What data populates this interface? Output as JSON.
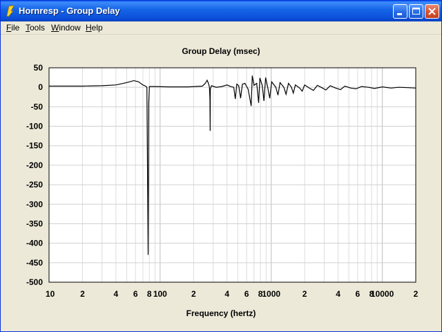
{
  "window": {
    "title": "Hornresp - Group Delay",
    "controls": [
      "minimize",
      "maximize",
      "close"
    ]
  },
  "menu": {
    "items": [
      {
        "label": "File",
        "accel": "F",
        "rest": "ile"
      },
      {
        "label": "Tools",
        "accel": "T",
        "rest": "ools"
      },
      {
        "label": "Window",
        "accel": "W",
        "rest": "indow"
      },
      {
        "label": "Help",
        "accel": "H",
        "rest": "elp"
      }
    ]
  },
  "chart_data": {
    "type": "line",
    "title": "Group Delay (msec)",
    "xlabel": "Frequency (hertz)",
    "ylabel": "",
    "xscale": "log",
    "xlim": [
      10,
      20000
    ],
    "ylim": [
      -500,
      50
    ],
    "yticks": [
      "50",
      "0",
      "-50",
      "-100",
      "-150",
      "-200",
      "-250",
      "-300",
      "-350",
      "-400",
      "-450",
      "-500"
    ],
    "xticks": [
      {
        "value": 10,
        "label": "10"
      },
      {
        "value": 20,
        "label": "2"
      },
      {
        "value": 40,
        "label": "4"
      },
      {
        "value": 60,
        "label": "6"
      },
      {
        "value": 80,
        "label": "8"
      },
      {
        "value": 100,
        "label": "100"
      },
      {
        "value": 200,
        "label": "2"
      },
      {
        "value": 400,
        "label": "4"
      },
      {
        "value": 600,
        "label": "6"
      },
      {
        "value": 800,
        "label": "8"
      },
      {
        "value": 1000,
        "label": "1000"
      },
      {
        "value": 2000,
        "label": "2"
      },
      {
        "value": 4000,
        "label": "4"
      },
      {
        "value": 6000,
        "label": "6"
      },
      {
        "value": 8000,
        "label": "8"
      },
      {
        "value": 10000,
        "label": "10000"
      },
      {
        "value": 20000,
        "label": "2"
      }
    ],
    "grid": true,
    "series": [
      {
        "color": "#000000",
        "points": [
          [
            10,
            3
          ],
          [
            20,
            3
          ],
          [
            30,
            4
          ],
          [
            40,
            6
          ],
          [
            50,
            12
          ],
          [
            58,
            17
          ],
          [
            64,
            14
          ],
          [
            70,
            6
          ],
          [
            74,
            3
          ],
          [
            76,
            0
          ],
          [
            77,
            -210
          ],
          [
            78,
            -430
          ],
          [
            79,
            -40
          ],
          [
            80,
            2
          ],
          [
            90,
            2
          ],
          [
            120,
            1
          ],
          [
            180,
            1
          ],
          [
            240,
            3
          ],
          [
            255,
            10
          ],
          [
            265,
            18
          ],
          [
            272,
            10
          ],
          [
            278,
            0
          ],
          [
            281,
            -30
          ],
          [
            282,
            -112
          ],
          [
            283,
            -5
          ],
          [
            290,
            4
          ],
          [
            320,
            0
          ],
          [
            360,
            2
          ],
          [
            400,
            6
          ],
          [
            430,
            2
          ],
          [
            460,
            0
          ],
          [
            475,
            -30
          ],
          [
            490,
            8
          ],
          [
            510,
            4
          ],
          [
            530,
            -28
          ],
          [
            550,
            8
          ],
          [
            580,
            10
          ],
          [
            620,
            -5
          ],
          [
            660,
            -48
          ],
          [
            675,
            30
          ],
          [
            700,
            5
          ],
          [
            740,
            10
          ],
          [
            770,
            -40
          ],
          [
            790,
            24
          ],
          [
            830,
            5
          ],
          [
            860,
            -35
          ],
          [
            890,
            25
          ],
          [
            930,
            0
          ],
          [
            970,
            -28
          ],
          [
            1010,
            14
          ],
          [
            1100,
            0
          ],
          [
            1150,
            -20
          ],
          [
            1200,
            12
          ],
          [
            1300,
            0
          ],
          [
            1360,
            -18
          ],
          [
            1430,
            10
          ],
          [
            1520,
            0
          ],
          [
            1580,
            -15
          ],
          [
            1650,
            6
          ],
          [
            1800,
            -2
          ],
          [
            1900,
            -10
          ],
          [
            2000,
            6
          ],
          [
            2200,
            -2
          ],
          [
            2400,
            -8
          ],
          [
            2600,
            5
          ],
          [
            2900,
            -2
          ],
          [
            3100,
            -7
          ],
          [
            3400,
            4
          ],
          [
            3800,
            -2
          ],
          [
            4200,
            -6
          ],
          [
            4600,
            3
          ],
          [
            5200,
            -2
          ],
          [
            5800,
            -4
          ],
          [
            6500,
            2
          ],
          [
            7500,
            0
          ],
          [
            8500,
            -3
          ],
          [
            10000,
            1
          ],
          [
            12000,
            -2
          ],
          [
            14000,
            0
          ],
          [
            17000,
            -1
          ],
          [
            20000,
            -2
          ]
        ]
      }
    ]
  }
}
